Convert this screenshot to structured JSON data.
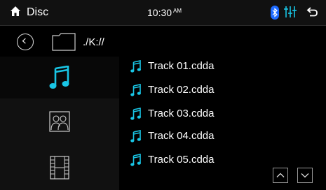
{
  "header": {
    "source": "Disc",
    "time": "10:30",
    "ampm": "AM",
    "icons": [
      "home-icon",
      "bluetooth-icon",
      "equalizer-icon",
      "back-arrow-icon"
    ]
  },
  "browser": {
    "path": "./K://",
    "categories": [
      {
        "name": "music",
        "icon": "music-note-icon",
        "selected": true
      },
      {
        "name": "photo",
        "icon": "photo-icon",
        "selected": false
      },
      {
        "name": "video",
        "icon": "film-icon",
        "selected": false
      }
    ],
    "tracks": [
      {
        "label": "Track 01.cdda"
      },
      {
        "label": "Track 02.cdda"
      },
      {
        "label": "Track 03.cdda"
      },
      {
        "label": "Track 04.cdda"
      },
      {
        "label": "Track 05.cdda"
      }
    ]
  },
  "colors": {
    "accent": "#19c6e6",
    "bluetooth": "#1e6bff"
  }
}
